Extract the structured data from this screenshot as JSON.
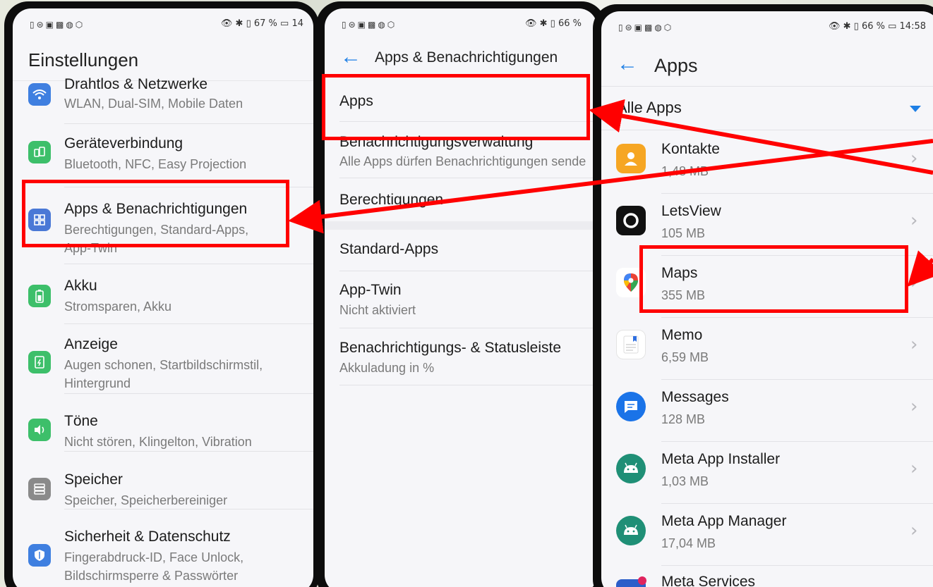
{
  "phone1": {
    "status_left": "▯⊜▣▩◍⬡",
    "status_right": "👁 ✱ ▯ 67 % ▭ 14",
    "title": "Einstellungen",
    "items": [
      {
        "title": "Drahtlos & Netzwerke",
        "subtitle": "WLAN, Dual-SIM, Mobile Daten",
        "icon": "wifi-icon",
        "color": "#3f7fe0"
      },
      {
        "title": "Geräteverbindung",
        "subtitle": "Bluetooth, NFC, Easy Projection",
        "icon": "device-connection-icon",
        "color": "#3dbf6a"
      },
      {
        "title": "Apps & Benachrichtigungen",
        "subtitle": "Berechtigungen, Standard-Apps,",
        "subtitle2": "App-Twin",
        "icon": "apps-grid-icon",
        "color": "#4a78d6"
      },
      {
        "title": "Akku",
        "subtitle": "Stromsparen, Akku",
        "icon": "battery-icon",
        "color": "#3dbf6a"
      },
      {
        "title": "Anzeige",
        "subtitle": "Augen schonen, Startbildschirmstil,",
        "subtitle2": "Hintergrund",
        "icon": "display-icon",
        "color": "#3dbf6a"
      },
      {
        "title": "Töne",
        "subtitle": "Nicht stören, Klingelton, Vibration",
        "icon": "sound-icon",
        "color": "#3dbf6a"
      },
      {
        "title": "Speicher",
        "subtitle": "Speicher, Speicherbereiniger",
        "icon": "storage-icon",
        "color": "#8a8a8a"
      },
      {
        "title": "Sicherheit & Datenschutz",
        "subtitle": "Fingerabdruck-ID, Face Unlock,",
        "subtitle2": "Bildschirmsperre & Passwörter",
        "icon": "shield-icon",
        "color": "#3f7fe0"
      }
    ]
  },
  "phone2": {
    "status_left": "▯⊜▣▩◍⬡",
    "status_right": "👁 ✱ ▯ 66 %",
    "title": "Apps & Benachrichtigungen",
    "items": [
      {
        "title": "Apps"
      },
      {
        "title": "Benachrichtigungsverwaltung",
        "subtitle": "Alle Apps dürfen Benachrichtigungen sende"
      },
      {
        "title": "Berechtigungen"
      },
      {
        "title": "Standard-Apps"
      },
      {
        "title": "App-Twin",
        "subtitle": "Nicht aktiviert"
      },
      {
        "title": "Benachrichtigungs- & Statusleiste",
        "subtitle": "Akkuladung in %"
      }
    ]
  },
  "phone3": {
    "status_left": "▯⊜▣▩◍⬡",
    "status_right": "👁 ✱ ▯ 66 % ▭ 14:58",
    "title": "Apps",
    "filter": "Alle Apps",
    "apps": [
      {
        "name": "Kontakte",
        "size": "1,48 MB",
        "icon": "contacts-icon"
      },
      {
        "name": "LetsView",
        "size": "105 MB",
        "icon": "letsview-icon"
      },
      {
        "name": "Maps",
        "size": "355 MB",
        "icon": "maps-icon"
      },
      {
        "name": "Memo",
        "size": "6,59 MB",
        "icon": "memo-icon"
      },
      {
        "name": "Messages",
        "size": "128 MB",
        "icon": "messages-icon"
      },
      {
        "name": "Meta App Installer",
        "size": "1,03 MB",
        "icon": "android-icon"
      },
      {
        "name": "Meta App Manager",
        "size": "17,04 MB",
        "icon": "android-icon"
      },
      {
        "name": "Meta Services",
        "size": "",
        "icon": "meta-icon"
      }
    ]
  },
  "colors": {
    "highlight": "#ff0000",
    "accent": "#1e7fe5"
  }
}
